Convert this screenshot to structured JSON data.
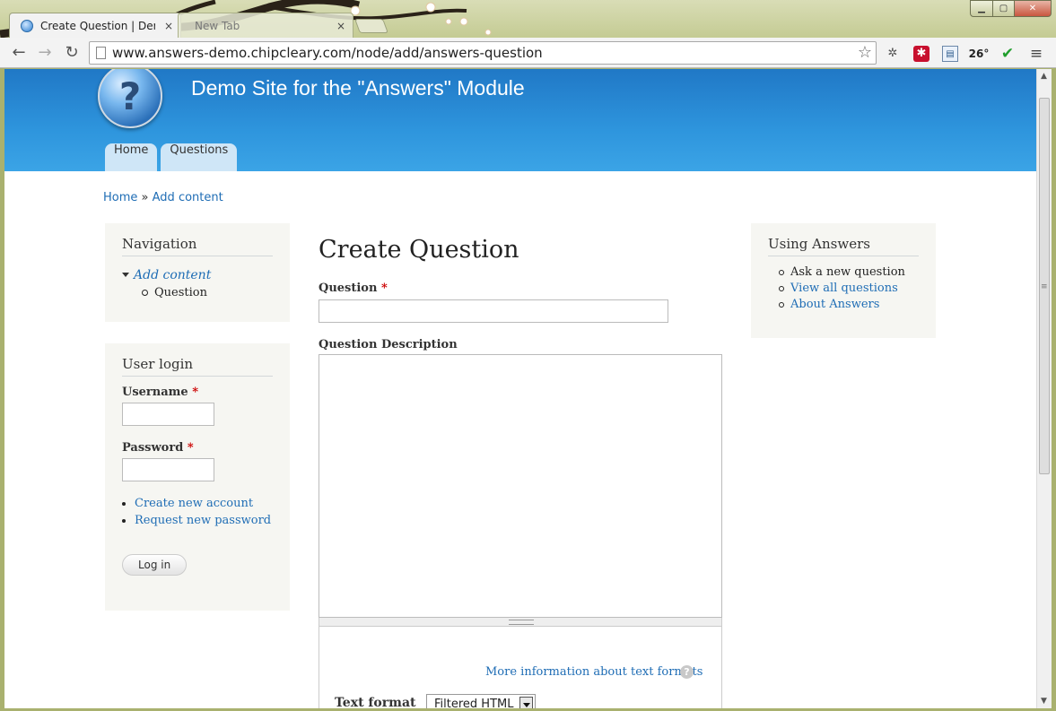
{
  "browser": {
    "tabs": [
      {
        "title": "Create Question | Demo Si",
        "close": "×"
      },
      {
        "title": "New Tab",
        "close": "×"
      }
    ],
    "url": "www.answers-demo.chipcleary.com/node/add/answers-question",
    "icons": {
      "back": "back-arrow-icon",
      "forward": "forward-arrow-icon",
      "reload": "reload-icon",
      "star": "bookmark-star-icon",
      "menu": "hamburger-menu-icon"
    },
    "extensions": {
      "temperature": "26°"
    }
  },
  "site": {
    "logo_glyph": "?",
    "name": "Demo Site for the \"Answers\" Module",
    "menu": [
      "Home",
      "Questions"
    ],
    "colors": {
      "header": "#2e95dd",
      "link": "#1f6db5",
      "required": "#cc0000"
    }
  },
  "breadcrumb": {
    "items": [
      "Home",
      "Add content"
    ],
    "separator": "»"
  },
  "navigation_block": {
    "title": "Navigation",
    "parent": "Add content",
    "child": "Question"
  },
  "login_block": {
    "title": "User login",
    "username_label": "Username",
    "password_label": "Password",
    "required_mark": "*",
    "links": [
      "Create new account",
      "Request new password"
    ],
    "submit": "Log in"
  },
  "answers_block": {
    "title": "Using Answers",
    "items": [
      {
        "text": "Ask a new question",
        "link": false
      },
      {
        "text": "View all questions",
        "link": true
      },
      {
        "text": "About Answers",
        "link": true
      }
    ]
  },
  "form": {
    "page_title": "Create Question",
    "question_label": "Question",
    "required_mark": "*",
    "question_value": "",
    "description_label": "Question Description",
    "description_value": "",
    "more_info": "More information about text formats",
    "help_glyph": "?",
    "text_format_label": "Text format",
    "text_format_value": "Filtered HTML"
  }
}
